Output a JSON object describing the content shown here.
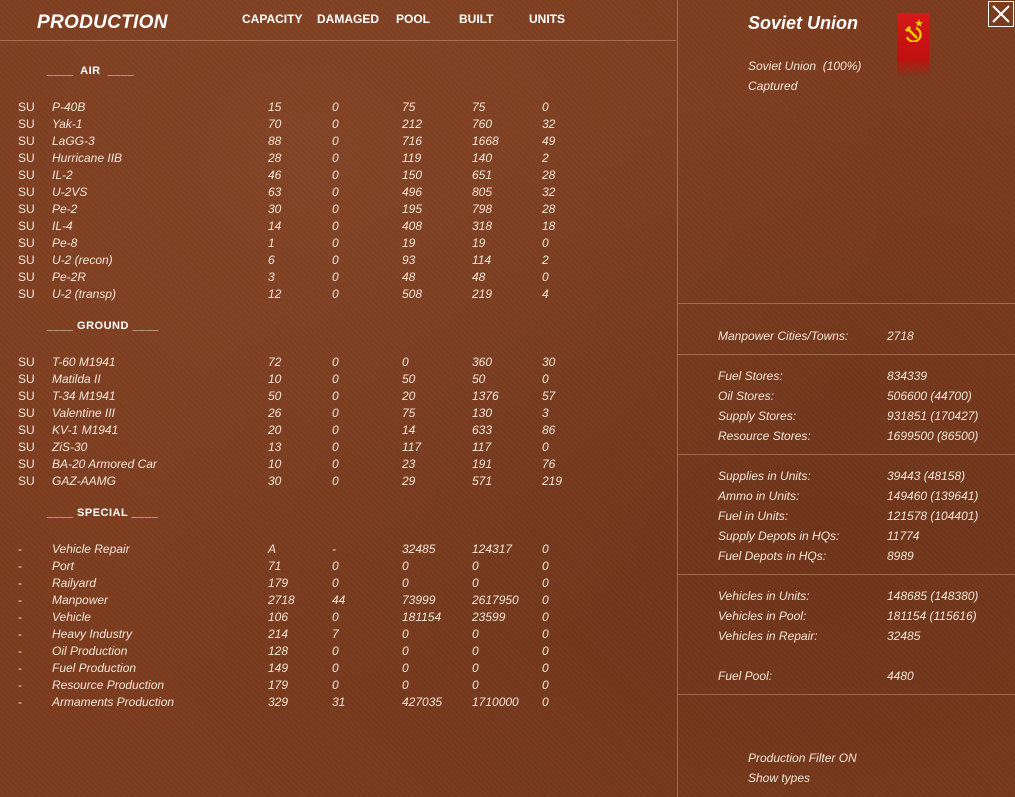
{
  "header": {
    "title": "PRODUCTION",
    "columns": [
      "CAPACITY",
      "DAMAGED",
      "POOL",
      "BUILT",
      "UNITS"
    ]
  },
  "sections": {
    "air": {
      "label": "____  AIR  ____",
      "rows": [
        [
          "SU",
          "P-40B",
          "15",
          "0",
          "75",
          "75",
          "0"
        ],
        [
          "SU",
          "Yak-1",
          "70",
          "0",
          "212",
          "760",
          "32"
        ],
        [
          "SU",
          "LaGG-3",
          "88",
          "0",
          "716",
          "1668",
          "49"
        ],
        [
          "SU",
          "Hurricane IIB",
          "28",
          "0",
          "119",
          "140",
          "2"
        ],
        [
          "SU",
          "IL-2",
          "46",
          "0",
          "150",
          "651",
          "28"
        ],
        [
          "SU",
          "U-2VS",
          "63",
          "0",
          "496",
          "805",
          "32"
        ],
        [
          "SU",
          "Pe-2",
          "30",
          "0",
          "195",
          "798",
          "28"
        ],
        [
          "SU",
          "IL-4",
          "14",
          "0",
          "408",
          "318",
          "18"
        ],
        [
          "SU",
          "Pe-8",
          "1",
          "0",
          "19",
          "19",
          "0"
        ],
        [
          "SU",
          "U-2 (recon)",
          "6",
          "0",
          "93",
          "114",
          "2"
        ],
        [
          "SU",
          "Pe-2R",
          "3",
          "0",
          "48",
          "48",
          "0"
        ],
        [
          "SU",
          "U-2 (transp)",
          "12",
          "0",
          "508",
          "219",
          "4"
        ]
      ]
    },
    "ground": {
      "label": "____ GROUND ____",
      "rows": [
        [
          "SU",
          "T-60 M1941",
          "72",
          "0",
          "0",
          "360",
          "30"
        ],
        [
          "SU",
          "Matilda II",
          "10",
          "0",
          "50",
          "50",
          "0"
        ],
        [
          "SU",
          "T-34 M1941",
          "50",
          "0",
          "20",
          "1376",
          "57"
        ],
        [
          "SU",
          "Valentine III",
          "26",
          "0",
          "75",
          "130",
          "3"
        ],
        [
          "SU",
          "KV-1 M1941",
          "20",
          "0",
          "14",
          "633",
          "86"
        ],
        [
          "SU",
          "ZiS-30",
          "13",
          "0",
          "117",
          "117",
          "0"
        ],
        [
          "SU",
          "BA-20 Armored Car",
          "10",
          "0",
          "23",
          "191",
          "76"
        ],
        [
          "SU",
          "GAZ-AAMG",
          "30",
          "0",
          "29",
          "571",
          "219"
        ]
      ]
    },
    "special": {
      "label": "____ SPECIAL ____",
      "rows": [
        [
          "-",
          "Vehicle Repair",
          "A",
          "-",
          "32485",
          "124317",
          "0"
        ],
        [
          "-",
          "Port",
          "71",
          "0",
          "0",
          "0",
          "0"
        ],
        [
          "-",
          "Railyard",
          "179",
          "0",
          "0",
          "0",
          "0"
        ],
        [
          "-",
          "Manpower",
          "2718",
          "44",
          "73999",
          "2617950",
          "0"
        ],
        [
          "-",
          "Vehicle",
          "106",
          "0",
          "181154",
          "23599",
          "0"
        ],
        [
          "-",
          "Heavy Industry",
          "214",
          "7",
          "0",
          "0",
          "0"
        ],
        [
          "-",
          "Oil Production",
          "128",
          "0",
          "0",
          "0",
          "0"
        ],
        [
          "-",
          "Fuel Production",
          "149",
          "0",
          "0",
          "0",
          "0"
        ],
        [
          "-",
          "Resource Production",
          "179",
          "0",
          "0",
          "0",
          "0"
        ],
        [
          "-",
          "Armaments Production",
          "329",
          "31",
          "427035",
          "1710000",
          "0"
        ]
      ]
    }
  },
  "side": {
    "nation": "Soviet Union",
    "control": "Soviet Union  (100%)",
    "status": "Captured",
    "close_icon": "close-icon",
    "flag_icon": "hammer-sickle-icon",
    "stats": [
      [
        [
          "Manpower Cities/Towns:",
          "2718"
        ]
      ],
      [
        [
          "Fuel Stores:",
          "834339"
        ],
        [
          "Oil Stores:",
          "506600 (44700)"
        ],
        [
          "Supply Stores:",
          "931851 (170427)"
        ],
        [
          "Resource Stores:",
          "1699500 (86500)"
        ]
      ],
      [
        [
          "Supplies in Units:",
          "39443 (48158)"
        ],
        [
          "Ammo in Units:",
          "149460 (139641)"
        ],
        [
          "Fuel in Units:",
          "121578 (104401)"
        ],
        [
          "Supply Depots in HQs:",
          "11774"
        ],
        [
          "Fuel Depots in HQs:",
          "8989"
        ]
      ],
      [
        [
          "Vehicles in Units:",
          "148685 (148380)"
        ],
        [
          "Vehicles in Pool:",
          "181154 (115616)"
        ],
        [
          "Vehicles in Repair:",
          "32485"
        ],
        [
          "",
          ""
        ],
        [
          "Fuel Pool:",
          "4480"
        ]
      ]
    ],
    "filter": "Production Filter ON",
    "show_types": "Show types"
  },
  "colors": {
    "background": "#7b3b1d",
    "text": "#f3e6d8",
    "heading": "#ffffff",
    "flag_red": "#d81818",
    "emblem_gold": "#f5d000"
  }
}
